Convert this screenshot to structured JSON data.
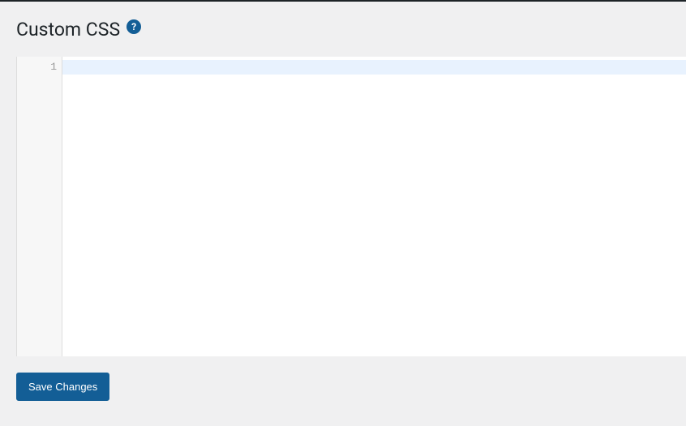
{
  "page": {
    "title": "Custom CSS"
  },
  "help": {
    "glyph": "?"
  },
  "editor": {
    "line_numbers": [
      "1"
    ],
    "content": ""
  },
  "actions": {
    "save_label": "Save Changes"
  }
}
